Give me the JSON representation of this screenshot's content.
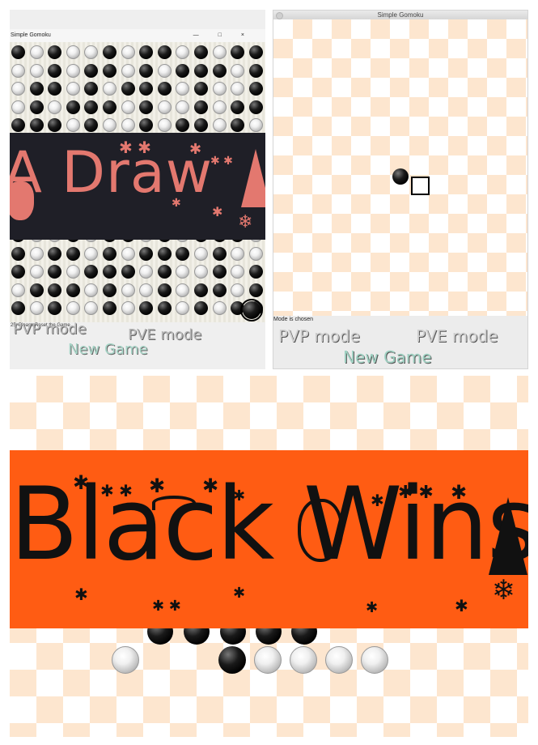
{
  "panel1": {
    "window_title": "Simple Gomoku",
    "window_controls": [
      "—",
      "□",
      "×"
    ],
    "banner_text": "A Draw",
    "status_text": "25. Please Reset the Game",
    "buttons": {
      "pvp": "PVP mode",
      "pve": "PVE mode",
      "new_game": "New Game"
    },
    "colors": {
      "banner_bg": "#1f1f27",
      "banner_text": "#e3786f"
    }
  },
  "panel2": {
    "window_title": "Simple Gomoku",
    "status_text": "Mode is chosen",
    "buttons": {
      "pvp": "PVP mode",
      "pve": "PVE mode",
      "new_game": "New Game"
    }
  },
  "panel3": {
    "banner_text": "Black Wins",
    "colors": {
      "banner_bg": "#ff5c13",
      "banner_text": "#111111",
      "board_tile": "#fde6cf"
    }
  }
}
